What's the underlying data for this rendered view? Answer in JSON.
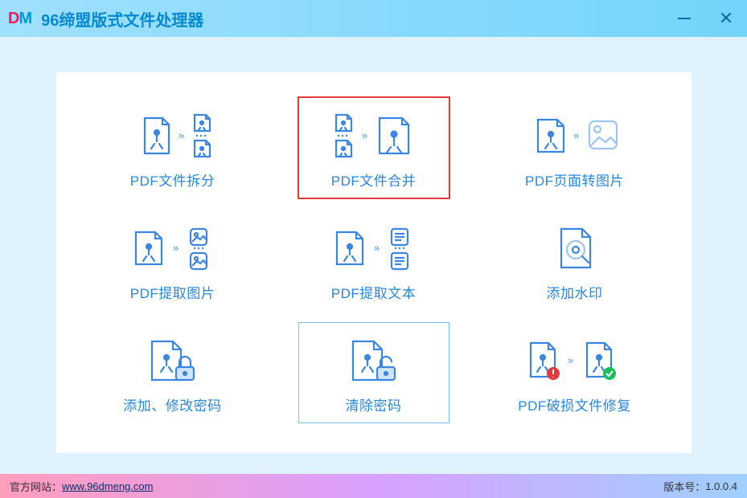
{
  "app": {
    "logo_d": "D",
    "logo_m": "M",
    "title": "96缔盟版式文件处理器"
  },
  "tiles": {
    "split": {
      "label": "PDF文件拆分"
    },
    "merge": {
      "label": "PDF文件合并"
    },
    "page2img": {
      "label": "PDF页面转图片"
    },
    "extract_img": {
      "label": "PDF提取图片"
    },
    "extract_txt": {
      "label": "PDF提取文本"
    },
    "watermark": {
      "label": "添加水印"
    },
    "password": {
      "label": "添加、修改密码"
    },
    "clear_pwd": {
      "label": "清除密码"
    },
    "repair": {
      "label": "PDF破损文件修复"
    }
  },
  "footer": {
    "site_label": "官方网站：",
    "site_url": "www.96dmeng.com",
    "version_label": "版本号：",
    "version": "1.0.0.4"
  },
  "icons": {
    "arrow": "»"
  }
}
